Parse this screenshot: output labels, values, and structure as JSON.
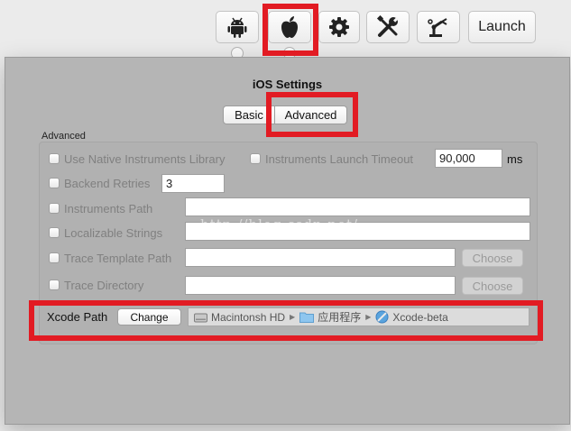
{
  "toolbar": {
    "items": [
      {
        "id": "android",
        "icon": "android-icon"
      },
      {
        "id": "ios",
        "icon": "apple-icon"
      },
      {
        "id": "settings",
        "icon": "gear-icon"
      },
      {
        "id": "tools",
        "icon": "wrench-screwdriver-icon"
      },
      {
        "id": "robot",
        "icon": "robot-arm-icon"
      }
    ],
    "launch_label": "Launch"
  },
  "sheet": {
    "title": "iOS Settings",
    "tabs": [
      {
        "label": "Basic",
        "selected": false
      },
      {
        "label": "Advanced",
        "selected": true
      }
    ],
    "group_label": "Advanced",
    "options": {
      "native_instruments": "Use Native Instruments Library",
      "launch_timeout_label": "Instruments Launch Timeout",
      "launch_timeout_value": "90,000",
      "timeout_unit": "ms",
      "backend_retries_label": "Backend Retries",
      "backend_retries_value": "3",
      "instruments_path": "Instruments Path",
      "localizable_strings": "Localizable Strings",
      "trace_template_path": "Trace Template Path",
      "trace_directory": "Trace Directory",
      "choose_label": "Choose"
    },
    "xcode": {
      "label": "Xcode Path",
      "change_label": "Change",
      "path": [
        "Macintonsh HD",
        "应用程序",
        "Xcode-beta"
      ]
    },
    "watermark": "http://blog.csdn.net/"
  },
  "colors": {
    "highlight_box": "#e21b23",
    "sheet_background": "#b5b5b5"
  }
}
